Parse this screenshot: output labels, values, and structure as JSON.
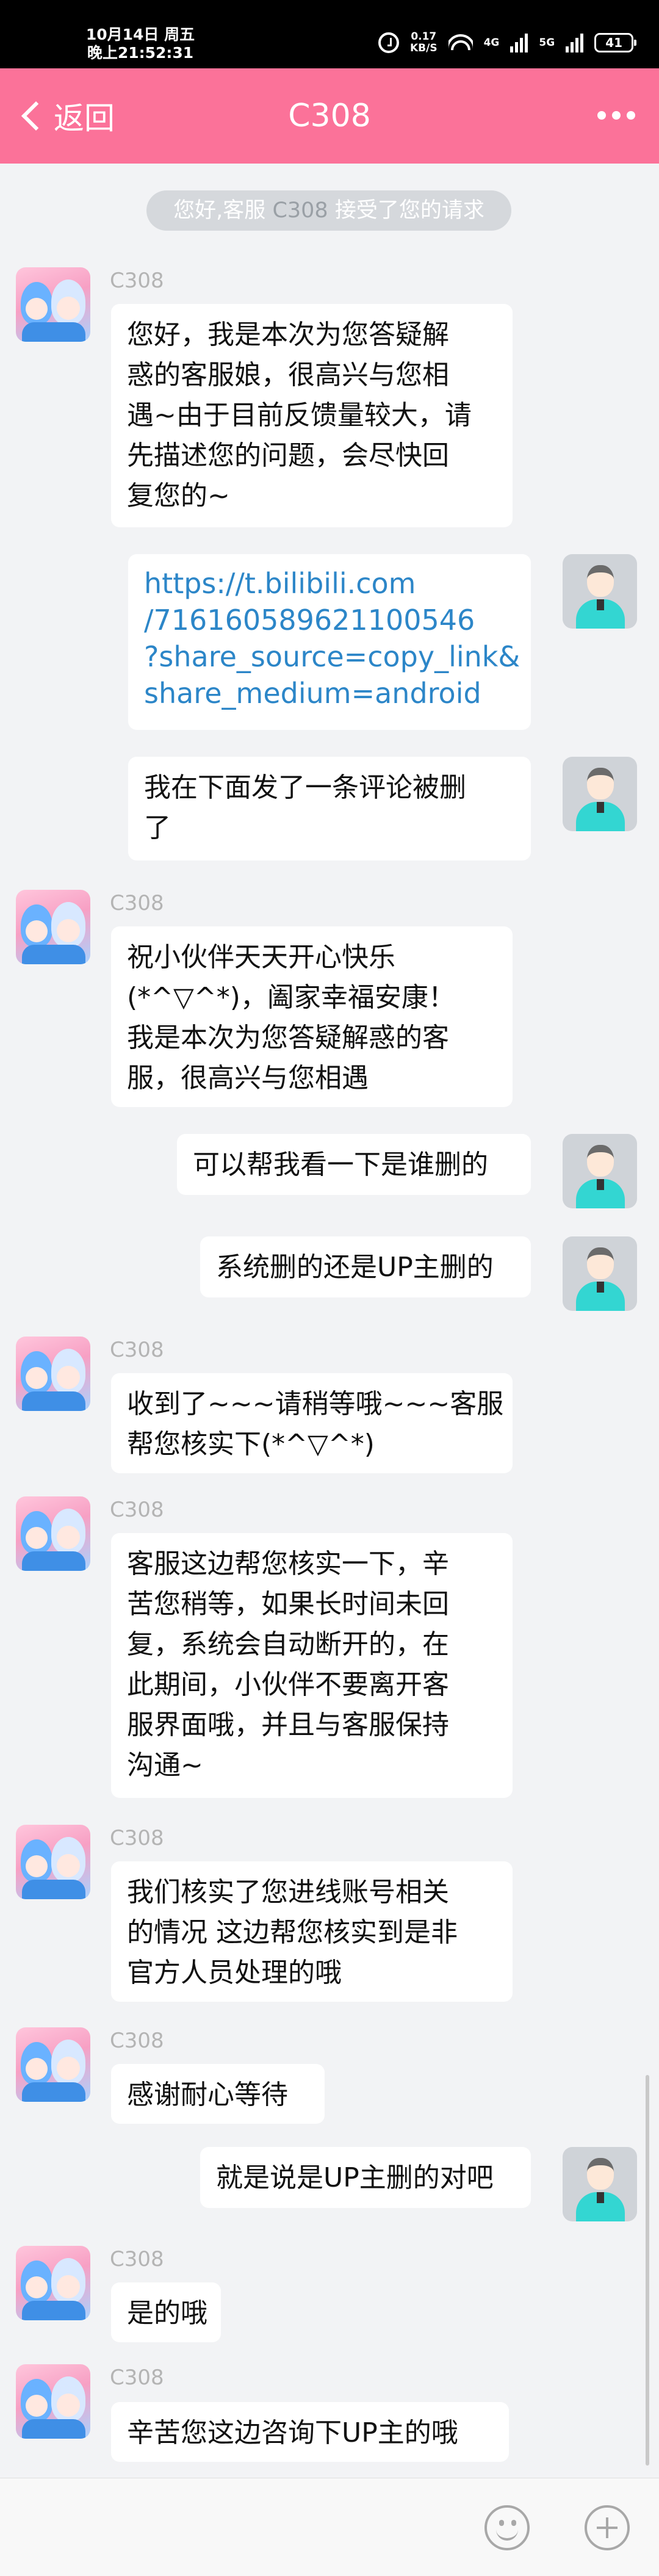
{
  "status_bar": {
    "date": "10月14日 周五",
    "time": "晚上21:52:31",
    "net_speed_value": "0.17",
    "net_speed_unit": "KB/S",
    "signal_1": "4G",
    "signal_2": "5G",
    "battery": "41"
  },
  "header": {
    "back_label": "返回",
    "title": "C308"
  },
  "system_note": {
    "prefix": "您好,客服 ",
    "agent": "C308",
    "suffix": " 接受了您的请求"
  },
  "messages": [
    {
      "from": "agent",
      "name": "C308",
      "lines": [
        "您好，我是本次为您答疑解",
        "惑的客服娘，很高兴与您相",
        "遇~由于目前反馈量较大，请",
        "先描述您的问题，会尽快回",
        "复您的~"
      ]
    },
    {
      "from": "user",
      "link": true,
      "lines": [
        "https://t.bilibili.com",
        "/716160589621100546",
        "?share_source=copy_link&",
        "share_medium=android"
      ]
    },
    {
      "from": "user",
      "lines": [
        "我在下面发了一条评论被删",
        "了"
      ]
    },
    {
      "from": "agent",
      "name": "C308",
      "lines": [
        "祝小伙伴天天开心快乐",
        "(*^▽^*)，阖家幸福安康！",
        "我是本次为您答疑解惑的客",
        "服，很高兴与您相遇"
      ]
    },
    {
      "from": "user",
      "lines": [
        "可以帮我看一下是谁删的"
      ]
    },
    {
      "from": "user",
      "lines": [
        "系统删的还是UP主删的"
      ]
    },
    {
      "from": "agent",
      "name": "C308",
      "lines": [
        "收到了~~~请稍等哦~~~客服",
        "帮您核实下(*^▽^*)"
      ]
    },
    {
      "from": "agent",
      "name": "C308",
      "lines": [
        "客服这边帮您核实一下，辛",
        "苦您稍等，如果长时间未回",
        "复，系统会自动断开的，在",
        "此期间，小伙伴不要离开客",
        "服界面哦，并且与客服保持",
        "沟通~"
      ]
    },
    {
      "from": "agent",
      "name": "C308",
      "lines": [
        "我们核实了您进线账号相关",
        "的情况 这边帮您核实到是非",
        "官方人员处理的哦"
      ]
    },
    {
      "from": "agent",
      "name": "C308",
      "lines": [
        "感谢耐心等待"
      ]
    },
    {
      "from": "user",
      "lines": [
        "就是说是UP主删的对吧"
      ]
    },
    {
      "from": "agent",
      "name": "C308",
      "lines": [
        "是的哦"
      ]
    },
    {
      "from": "agent",
      "name": "C308",
      "lines": [
        "辛苦您这边咨询下UP主的哦"
      ]
    }
  ],
  "input": {
    "value": "",
    "placeholder": ""
  },
  "icons": {
    "back": "chevron-left-icon",
    "more": "more-dots-icon",
    "emoji": "emoji-icon",
    "plus": "plus-icon"
  },
  "colors": {
    "header": "#fb7299",
    "link": "#2c86c8",
    "background": "#f2f3f5"
  }
}
